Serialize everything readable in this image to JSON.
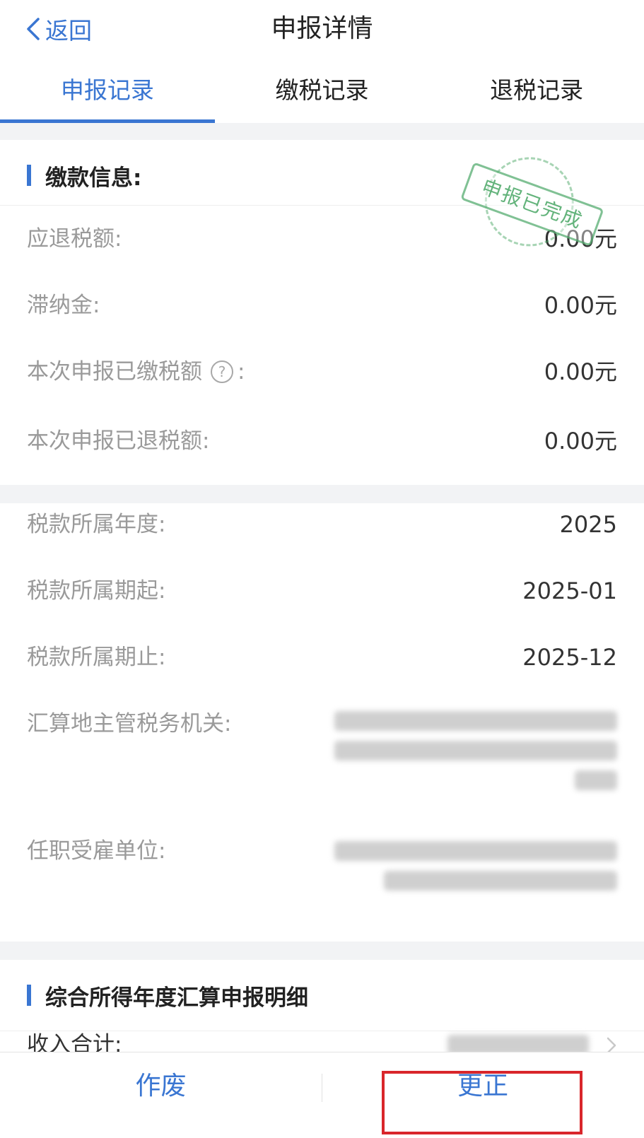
{
  "header": {
    "back_label": "返回",
    "title": "申报详情"
  },
  "tabs": [
    {
      "label": "申报记录",
      "active": true
    },
    {
      "label": "缴税记录",
      "active": false
    },
    {
      "label": "退税记录",
      "active": false
    }
  ],
  "payment_section": {
    "title": "缴款信息:",
    "stamp_text": "申报已完成",
    "rows": [
      {
        "label": "应退税额:",
        "value": "0.00元"
      },
      {
        "label": "滞纳金:",
        "value": "0.00元"
      },
      {
        "label": "本次申报已缴税额",
        "label_suffix": ":",
        "value": "0.00元",
        "help_icon": "question-circle-icon"
      },
      {
        "label": "本次申报已退税额:",
        "value": "0.00元"
      }
    ]
  },
  "period_section": {
    "rows": [
      {
        "label": "税款所属年度:",
        "value": "2025"
      },
      {
        "label": "税款所属期起:",
        "value": "2025-01"
      },
      {
        "label": "税款所属期止:",
        "value": "2025-12"
      },
      {
        "label": "汇算地主管税务机关:",
        "value": ""
      },
      {
        "label": "任职受雇单位:",
        "value": ""
      }
    ]
  },
  "detail_section": {
    "title": "综合所得年度汇算申报明细",
    "rows": [
      {
        "label": "收入合计:",
        "value": ""
      }
    ]
  },
  "footer": {
    "void_label": "作废",
    "correct_label": "更正"
  },
  "colors": {
    "accent": "#3a76d2",
    "highlight_box": "#d9262b",
    "stamp": "#3ca05a"
  }
}
